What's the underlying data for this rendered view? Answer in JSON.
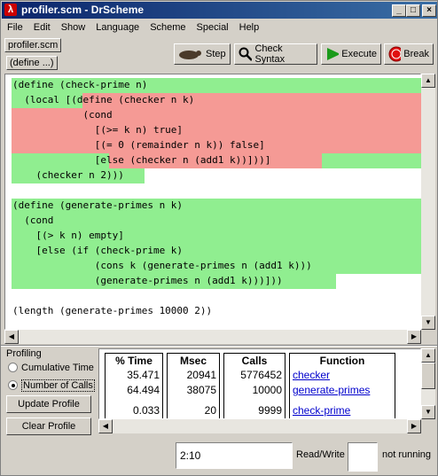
{
  "window": {
    "title": "profiler.scm - DrScheme",
    "controls": {
      "minimize": "_",
      "maximize": "□",
      "close": "×"
    }
  },
  "menu": [
    "File",
    "Edit",
    "Show",
    "Language",
    "Scheme",
    "Special",
    "Help"
  ],
  "toolbar": {
    "file_name": "profiler.scm",
    "define_menu": "(define ...)",
    "step": "Step",
    "check_syntax": "Check Syntax",
    "execute": "Execute",
    "break": "Break"
  },
  "editor": {
    "lines": [
      "(define (check-prime n)",
      "  (local [(define (checker n k)",
      "            (cond",
      "              [(>= k n) true]",
      "              [(= 0 (remainder n k)) false]",
      "              [else (checker n (add1 k))]))]",
      "    (checker n 2)))",
      "",
      "(define (generate-primes n k)",
      "  (cond",
      "    [(> k n) empty]",
      "    [else (if (check-prime k)",
      "              (cons k (generate-primes n (add1 k)))",
      "              (generate-primes n (add1 k)))]))",
      "",
      "(length (generate-primes 10000 2))"
    ]
  },
  "profiling": {
    "title": "Profiling",
    "option_cumulative": "Cumulative Time",
    "option_calls": "Number of Calls",
    "update": "Update Profile",
    "clear": "Clear Profile",
    "headers": {
      "time": "% Time",
      "msec": "Msec",
      "calls": "Calls",
      "function": "Function"
    },
    "rows": [
      {
        "time": "35.471",
        "msec": "20941",
        "calls": "5776452",
        "function": "checker"
      },
      {
        "time": "64.494",
        "msec": "38075",
        "calls": "10000",
        "function": "generate-primes"
      },
      {
        "time": "0.033",
        "msec": "20",
        "calls": "9999",
        "function": "check-prime"
      }
    ]
  },
  "status": {
    "position": "2:10",
    "mode": "Read/Write",
    "state": "not running"
  }
}
